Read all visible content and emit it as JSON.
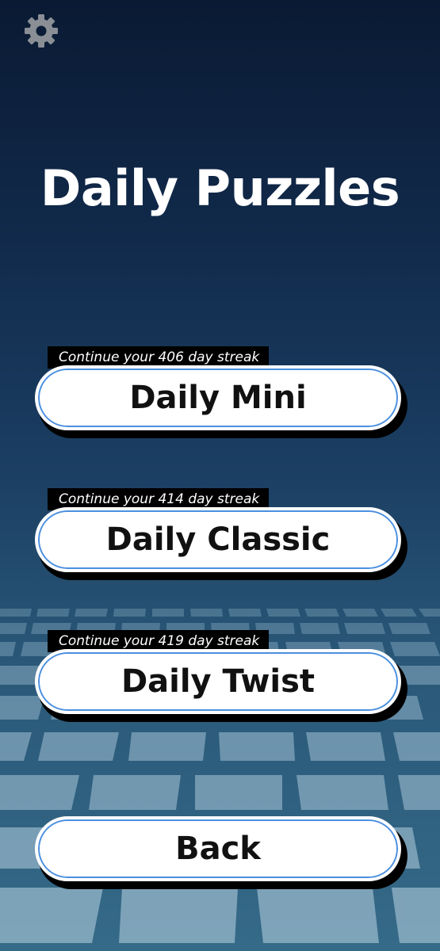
{
  "title": "Daily Puzzles",
  "settings_icon": "gear-icon",
  "colors": {
    "accent": "#4a8fe0",
    "background_top": "#0a1a33",
    "background_bottom": "#356a88",
    "button_fill": "#ffffff",
    "tag_fill": "#000000"
  },
  "puzzles": [
    {
      "label": "Daily Mini",
      "streak_text": "Continue your 406 day streak"
    },
    {
      "label": "Daily Classic",
      "streak_text": "Continue your 414 day streak"
    },
    {
      "label": "Daily Twist",
      "streak_text": "Continue your 419 day streak"
    }
  ],
  "back_label": "Back"
}
